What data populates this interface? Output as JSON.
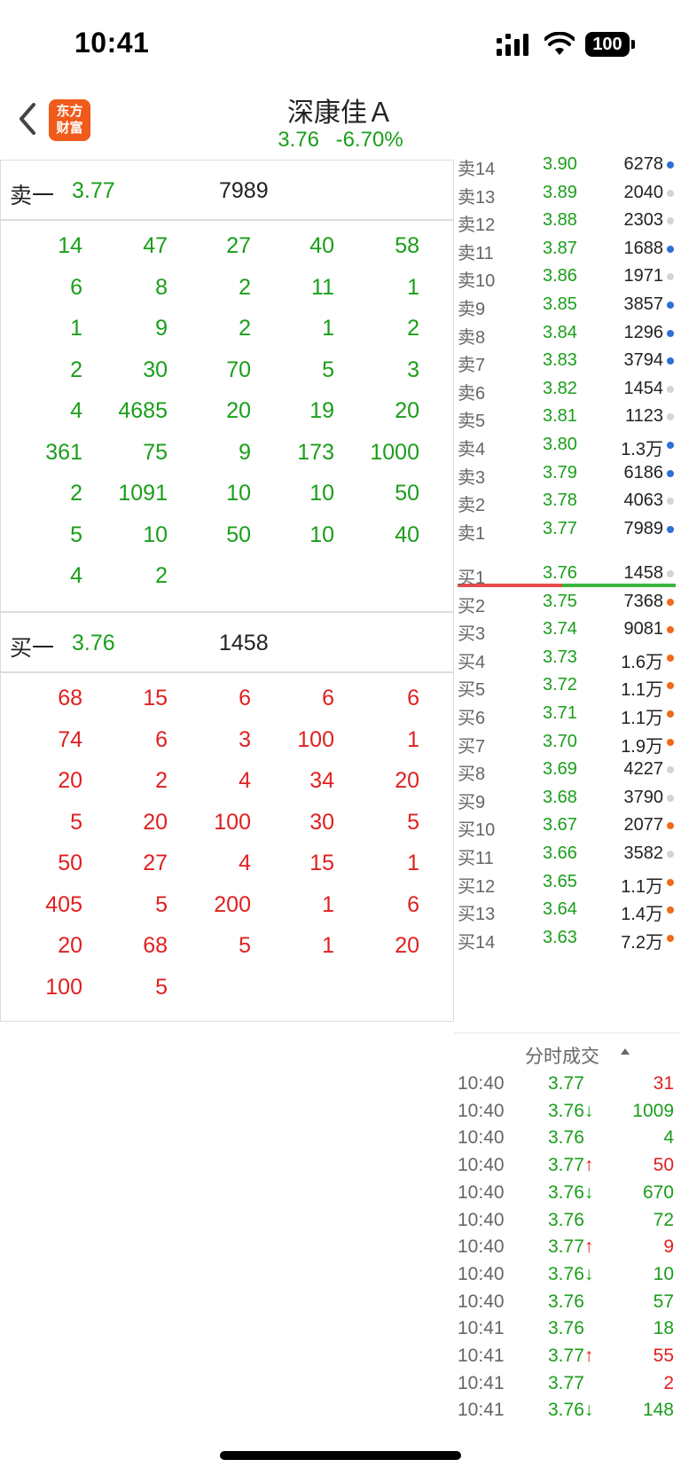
{
  "status_bar": {
    "time": "10:41",
    "battery": "100"
  },
  "header": {
    "logo_line1": "东方",
    "logo_line2": "财富",
    "stock_name": "深康佳Ａ",
    "price": "3.76",
    "change_pct": "-6.70%"
  },
  "sell_level": {
    "label": "卖一",
    "price": "3.77",
    "volume": "7989"
  },
  "buy_level": {
    "label": "买一",
    "price": "3.76",
    "volume": "1458"
  },
  "sell_queue": [
    [
      "14",
      "47",
      "27",
      "40",
      "58"
    ],
    [
      "6",
      "8",
      "2",
      "11",
      "1"
    ],
    [
      "1",
      "9",
      "2",
      "1",
      "2"
    ],
    [
      "2",
      "30",
      "70",
      "5",
      "3"
    ],
    [
      "4",
      "4685",
      "20",
      "19",
      "20"
    ],
    [
      "361",
      "75",
      "9",
      "173",
      "1000"
    ],
    [
      "2",
      "1091",
      "10",
      "10",
      "50"
    ],
    [
      "5",
      "10",
      "50",
      "10",
      "40"
    ],
    [
      "4",
      "2"
    ]
  ],
  "buy_queue": [
    [
      "68",
      "15",
      "6",
      "6",
      "6"
    ],
    [
      "74",
      "6",
      "3",
      "100",
      "1"
    ],
    [
      "20",
      "2",
      "4",
      "34",
      "20"
    ],
    [
      "5",
      "20",
      "100",
      "30",
      "5"
    ],
    [
      "50",
      "27",
      "4",
      "15",
      "1"
    ],
    [
      "405",
      "5",
      "200",
      "1",
      "6"
    ],
    [
      "20",
      "68",
      "5",
      "1",
      "20"
    ],
    [
      "100",
      "5"
    ]
  ],
  "asks": [
    {
      "label": "卖14",
      "price": "3.90",
      "volume": "6278",
      "dot": "blue"
    },
    {
      "label": "卖13",
      "price": "3.89",
      "volume": "2040",
      "dot": "gray"
    },
    {
      "label": "卖12",
      "price": "3.88",
      "volume": "2303",
      "dot": "gray"
    },
    {
      "label": "卖11",
      "price": "3.87",
      "volume": "1688",
      "dot": "blue"
    },
    {
      "label": "卖10",
      "price": "3.86",
      "volume": "1971",
      "dot": "gray"
    },
    {
      "label": "卖9",
      "price": "3.85",
      "volume": "3857",
      "dot": "blue"
    },
    {
      "label": "卖8",
      "price": "3.84",
      "volume": "1296",
      "dot": "blue"
    },
    {
      "label": "卖7",
      "price": "3.83",
      "volume": "3794",
      "dot": "blue"
    },
    {
      "label": "卖6",
      "price": "3.82",
      "volume": "1454",
      "dot": "gray"
    },
    {
      "label": "卖5",
      "price": "3.81",
      "volume": "1123",
      "dot": "gray"
    },
    {
      "label": "卖4",
      "price": "3.80",
      "volume": "1.3万",
      "dot": "blue"
    },
    {
      "label": "卖3",
      "price": "3.79",
      "volume": "6186",
      "dot": "blue"
    },
    {
      "label": "卖2",
      "price": "3.78",
      "volume": "4063",
      "dot": "gray"
    },
    {
      "label": "卖1",
      "price": "3.77",
      "volume": "7989",
      "dot": "blue"
    }
  ],
  "bids": [
    {
      "label": "买1",
      "price": "3.76",
      "volume": "1458",
      "dot": "gray"
    },
    {
      "label": "买2",
      "price": "3.75",
      "volume": "7368",
      "dot": "orange"
    },
    {
      "label": "买3",
      "price": "3.74",
      "volume": "9081",
      "dot": "orange"
    },
    {
      "label": "买4",
      "price": "3.73",
      "volume": "1.6万",
      "dot": "orange"
    },
    {
      "label": "买5",
      "price": "3.72",
      "volume": "1.1万",
      "dot": "orange"
    },
    {
      "label": "买6",
      "price": "3.71",
      "volume": "1.1万",
      "dot": "orange"
    },
    {
      "label": "买7",
      "price": "3.70",
      "volume": "1.9万",
      "dot": "orange"
    },
    {
      "label": "买8",
      "price": "3.69",
      "volume": "4227",
      "dot": "gray"
    },
    {
      "label": "买9",
      "price": "3.68",
      "volume": "3790",
      "dot": "gray"
    },
    {
      "label": "买10",
      "price": "3.67",
      "volume": "2077",
      "dot": "orange"
    },
    {
      "label": "买11",
      "price": "3.66",
      "volume": "3582",
      "dot": "gray"
    },
    {
      "label": "买12",
      "price": "3.65",
      "volume": "1.1万",
      "dot": "orange"
    },
    {
      "label": "买13",
      "price": "3.64",
      "volume": "1.4万",
      "dot": "orange"
    },
    {
      "label": "买14",
      "price": "3.63",
      "volume": "7.2万",
      "dot": "orange"
    }
  ],
  "buy_sell_ratio": 0.48,
  "trades_title": "分时成交",
  "trades": [
    {
      "time": "10:40",
      "price": "3.77",
      "volume": "31",
      "dir": "none",
      "vol_color": "red"
    },
    {
      "time": "10:40",
      "price": "3.76↓",
      "volume": "1009",
      "dir": "down",
      "vol_color": "green"
    },
    {
      "time": "10:40",
      "price": "3.76",
      "volume": "4",
      "dir": "none",
      "vol_color": "green"
    },
    {
      "time": "10:40",
      "price": "3.77↑",
      "volume": "50",
      "dir": "up",
      "vol_color": "red"
    },
    {
      "time": "10:40",
      "price": "3.76↓",
      "volume": "670",
      "dir": "down",
      "vol_color": "green"
    },
    {
      "time": "10:40",
      "price": "3.76",
      "volume": "72",
      "dir": "none",
      "vol_color": "green"
    },
    {
      "time": "10:40",
      "price": "3.77↑",
      "volume": "9",
      "dir": "up",
      "vol_color": "red"
    },
    {
      "time": "10:40",
      "price": "3.76↓",
      "volume": "10",
      "dir": "down",
      "vol_color": "green"
    },
    {
      "time": "10:40",
      "price": "3.76",
      "volume": "57",
      "dir": "none",
      "vol_color": "green"
    },
    {
      "time": "10:41",
      "price": "3.76",
      "volume": "18",
      "dir": "none",
      "vol_color": "green"
    },
    {
      "time": "10:41",
      "price": "3.77↑",
      "volume": "55",
      "dir": "up",
      "vol_color": "red"
    },
    {
      "time": "10:41",
      "price": "3.77",
      "volume": "2",
      "dir": "none",
      "vol_color": "red"
    },
    {
      "time": "10:41",
      "price": "3.76↓",
      "volume": "148",
      "dir": "down",
      "vol_color": "green"
    }
  ],
  "colors": {
    "down": "#1a9e1a",
    "up": "#e02020",
    "dot_blue": "#2f6fd6",
    "dot_gray": "#d4d4d4",
    "dot_orange": "#f06a1a"
  }
}
